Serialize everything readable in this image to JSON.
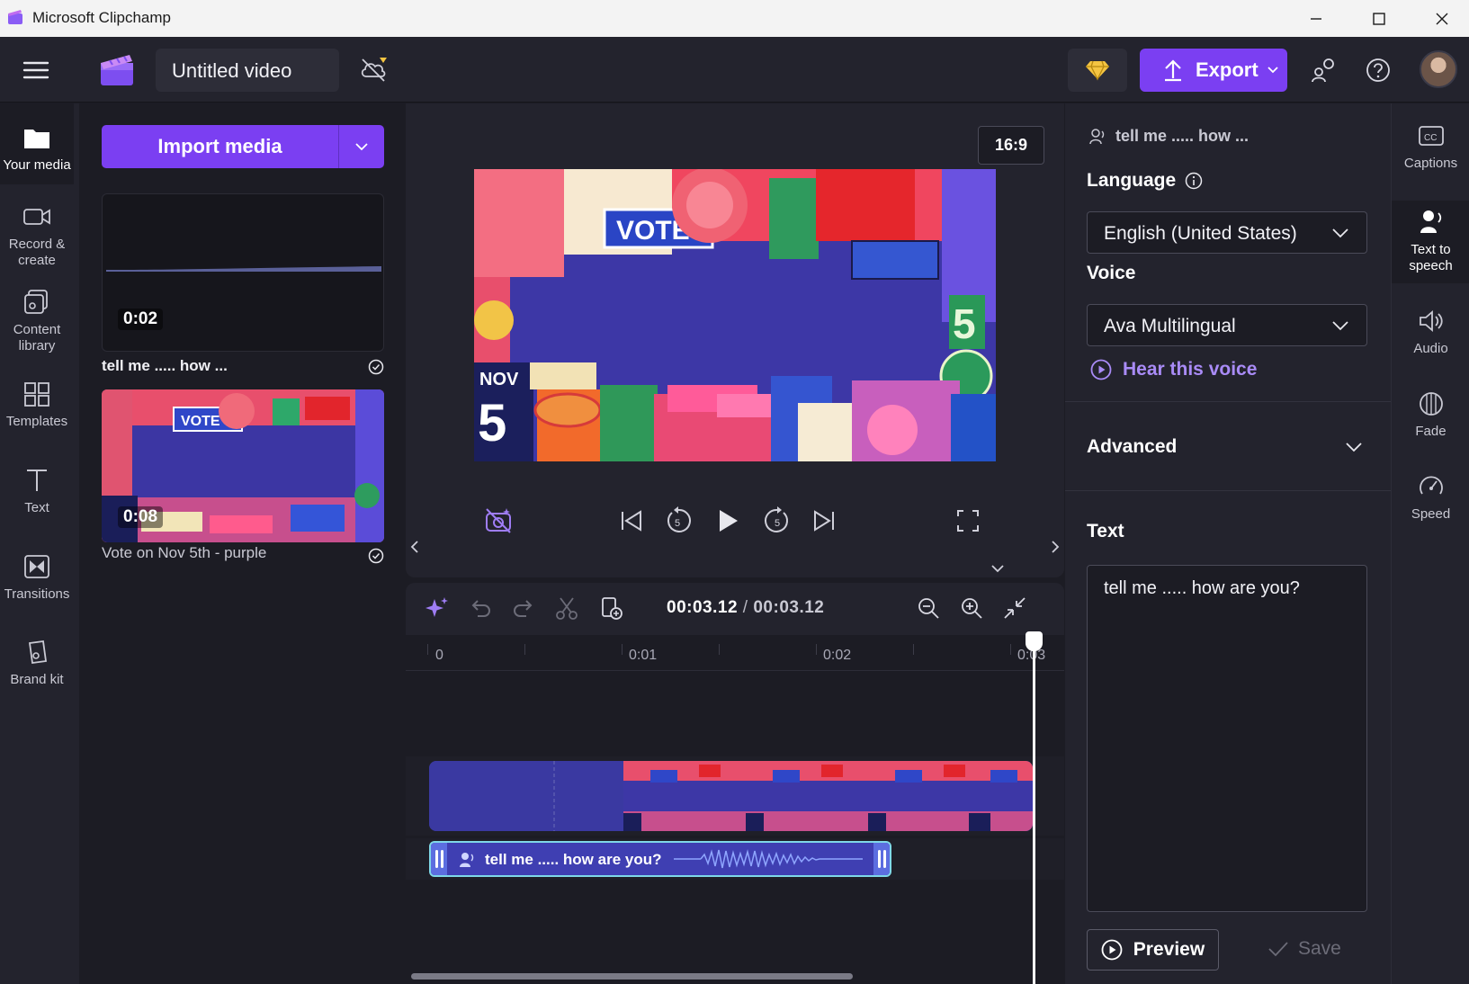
{
  "window": {
    "title": "Microsoft Clipchamp"
  },
  "header": {
    "project_title": "Untitled video",
    "export_label": "Export"
  },
  "left_rail": {
    "items": [
      {
        "label": "Your media",
        "icon": "folder-icon"
      },
      {
        "label": "Record &\ncreate",
        "icon": "camera-icon"
      },
      {
        "label": "Content\nlibrary",
        "icon": "content-library-icon"
      },
      {
        "label": "Templates",
        "icon": "templates-icon"
      },
      {
        "label": "Text",
        "icon": "text-icon"
      },
      {
        "label": "Transitions",
        "icon": "transitions-icon"
      },
      {
        "label": "Brand kit",
        "icon": "brand-kit-icon"
      }
    ]
  },
  "media_panel": {
    "import_label": "Import media",
    "items": [
      {
        "title": "tell me ..... how ...",
        "duration": "0:02",
        "type": "audio"
      },
      {
        "title": "Vote on Nov 5th - purple",
        "duration": "0:08",
        "type": "video"
      }
    ]
  },
  "preview": {
    "aspect_ratio": "16:9",
    "video_text": {
      "vote": "VOTE",
      "nov": "NOV",
      "five": "5"
    }
  },
  "timeline": {
    "current_time": "00:03.12",
    "separator": "/",
    "total_time": "00:03.12",
    "ruler_labels": [
      "0",
      "0:01",
      "0:02",
      "0:03"
    ],
    "audio_clip_label": "tell me ..... how are you?"
  },
  "properties": {
    "header": "tell me ..... how ...",
    "language_label": "Language",
    "language_value": "English (United States)",
    "voice_label": "Voice",
    "voice_value": "Ava Multilingual",
    "hear_voice": "Hear this voice",
    "advanced_label": "Advanced",
    "text_label": "Text",
    "text_value": "tell me ..... how are you?",
    "preview_label": "Preview",
    "save_label": "Save"
  },
  "right_rail": {
    "items": [
      {
        "label": "Captions",
        "icon": "captions-icon"
      },
      {
        "label": "Text to\nspeech",
        "icon": "text-to-speech-icon"
      },
      {
        "label": "Audio",
        "icon": "speaker-icon"
      },
      {
        "label": "Fade",
        "icon": "fade-icon"
      },
      {
        "label": "Speed",
        "icon": "speed-icon"
      }
    ]
  },
  "colors": {
    "accent": "#7b3ff2",
    "background": "#1c1c24",
    "panel": "#23232d",
    "link": "#a98bf7"
  }
}
